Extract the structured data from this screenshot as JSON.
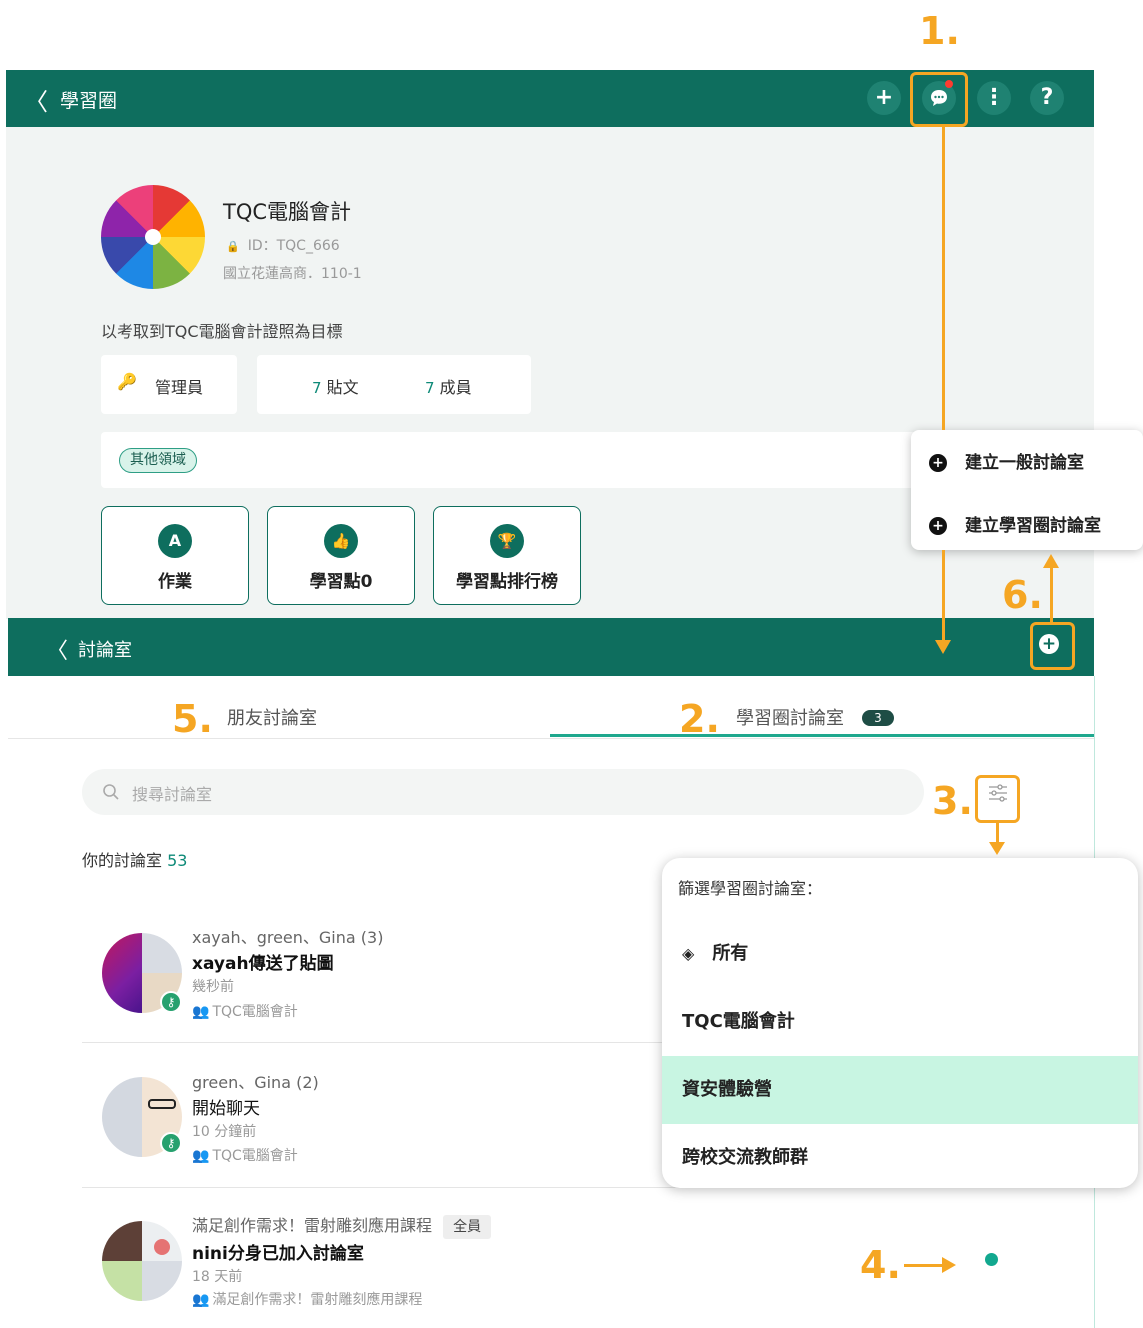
{
  "top_header": {
    "back_label": "〈",
    "title": "學習圈"
  },
  "group": {
    "name": "TQC電腦會計",
    "id_text": "ID：TQC_666",
    "school": "國立花蓮高商．110-1",
    "description": "以考取到TQC電腦會計證照為目標",
    "role_label": "管理員",
    "posts_count": "7",
    "posts_label": "貼文",
    "members_count": "7",
    "members_label": "成員",
    "tag": "其他領域",
    "tiles": [
      {
        "icon_char": "A",
        "label": "作業"
      },
      {
        "icon_char": "👍",
        "label": "學習點0"
      },
      {
        "icon_char": "🏆",
        "label": "學習點排行榜"
      }
    ]
  },
  "create_menu": {
    "items": [
      "建立一般討論室",
      "建立學習圈討論室"
    ]
  },
  "discussion_header": {
    "back_label": "〈",
    "title": "討論室"
  },
  "tabs": [
    {
      "label": "朋友討論室"
    },
    {
      "label": "學習圈討論室",
      "badge": "3"
    }
  ],
  "search": {
    "placeholder": "搜尋討論室"
  },
  "section": {
    "label": "你的討論室",
    "count": "53"
  },
  "rooms": [
    {
      "people": "xayah、green、Gina (3)",
      "message": "xayah傳送了貼圖",
      "time": "幾秒前",
      "group": "TQC電腦會計"
    },
    {
      "people": "green、Gina (2)",
      "message": "開始聊天",
      "time": "10 分鐘前",
      "group": "TQC電腦會計"
    },
    {
      "people": "滿足創作需求！雷射雕刻應用課程",
      "people_tag": "全員",
      "message": "nini分身已加入討論室",
      "time": "18 天前",
      "group": "滿足創作需求！雷射雕刻應用課程"
    }
  ],
  "filter_menu": {
    "title": "篩選學習圈討論室：",
    "options": [
      {
        "label": "所有",
        "selected": false
      },
      {
        "label": "TQC電腦會計",
        "selected": false
      },
      {
        "label": "資安體驗營",
        "selected": true
      },
      {
        "label": "跨校交流教師群",
        "selected": false
      }
    ]
  },
  "annotations": [
    "1.",
    "2.",
    "3.",
    "4.",
    "5.",
    "6."
  ],
  "colors": {
    "primary": "#0E6E5E",
    "annotation": "#F5A623",
    "selected_bg": "#C8F5E2",
    "unread": "#12A88F"
  }
}
